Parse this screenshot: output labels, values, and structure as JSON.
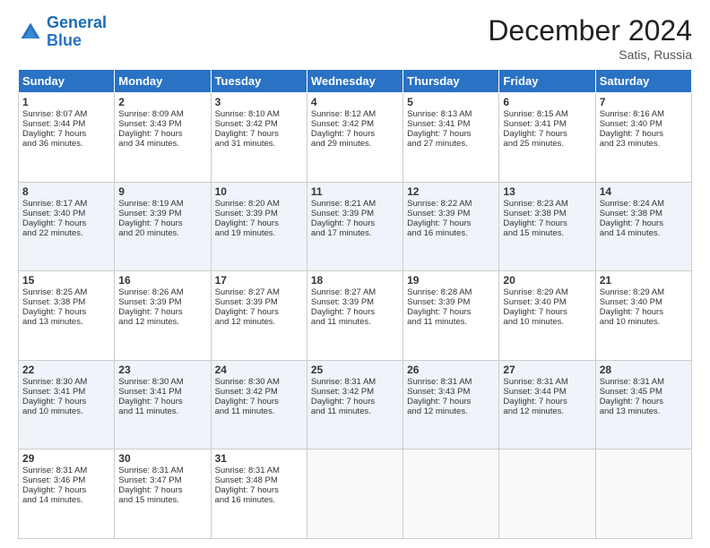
{
  "header": {
    "logo_line1": "General",
    "logo_line2": "Blue",
    "month_title": "December 2024",
    "subtitle": "Satis, Russia"
  },
  "weekdays": [
    "Sunday",
    "Monday",
    "Tuesday",
    "Wednesday",
    "Thursday",
    "Friday",
    "Saturday"
  ],
  "weeks": [
    [
      {
        "day": "1",
        "lines": [
          "Sunrise: 8:07 AM",
          "Sunset: 3:44 PM",
          "Daylight: 7 hours",
          "and 36 minutes."
        ]
      },
      {
        "day": "2",
        "lines": [
          "Sunrise: 8:09 AM",
          "Sunset: 3:43 PM",
          "Daylight: 7 hours",
          "and 34 minutes."
        ]
      },
      {
        "day": "3",
        "lines": [
          "Sunrise: 8:10 AM",
          "Sunset: 3:42 PM",
          "Daylight: 7 hours",
          "and 31 minutes."
        ]
      },
      {
        "day": "4",
        "lines": [
          "Sunrise: 8:12 AM",
          "Sunset: 3:42 PM",
          "Daylight: 7 hours",
          "and 29 minutes."
        ]
      },
      {
        "day": "5",
        "lines": [
          "Sunrise: 8:13 AM",
          "Sunset: 3:41 PM",
          "Daylight: 7 hours",
          "and 27 minutes."
        ]
      },
      {
        "day": "6",
        "lines": [
          "Sunrise: 8:15 AM",
          "Sunset: 3:41 PM",
          "Daylight: 7 hours",
          "and 25 minutes."
        ]
      },
      {
        "day": "7",
        "lines": [
          "Sunrise: 8:16 AM",
          "Sunset: 3:40 PM",
          "Daylight: 7 hours",
          "and 23 minutes."
        ]
      }
    ],
    [
      {
        "day": "8",
        "lines": [
          "Sunrise: 8:17 AM",
          "Sunset: 3:40 PM",
          "Daylight: 7 hours",
          "and 22 minutes."
        ]
      },
      {
        "day": "9",
        "lines": [
          "Sunrise: 8:19 AM",
          "Sunset: 3:39 PM",
          "Daylight: 7 hours",
          "and 20 minutes."
        ]
      },
      {
        "day": "10",
        "lines": [
          "Sunrise: 8:20 AM",
          "Sunset: 3:39 PM",
          "Daylight: 7 hours",
          "and 19 minutes."
        ]
      },
      {
        "day": "11",
        "lines": [
          "Sunrise: 8:21 AM",
          "Sunset: 3:39 PM",
          "Daylight: 7 hours",
          "and 17 minutes."
        ]
      },
      {
        "day": "12",
        "lines": [
          "Sunrise: 8:22 AM",
          "Sunset: 3:39 PM",
          "Daylight: 7 hours",
          "and 16 minutes."
        ]
      },
      {
        "day": "13",
        "lines": [
          "Sunrise: 8:23 AM",
          "Sunset: 3:38 PM",
          "Daylight: 7 hours",
          "and 15 minutes."
        ]
      },
      {
        "day": "14",
        "lines": [
          "Sunrise: 8:24 AM",
          "Sunset: 3:38 PM",
          "Daylight: 7 hours",
          "and 14 minutes."
        ]
      }
    ],
    [
      {
        "day": "15",
        "lines": [
          "Sunrise: 8:25 AM",
          "Sunset: 3:38 PM",
          "Daylight: 7 hours",
          "and 13 minutes."
        ]
      },
      {
        "day": "16",
        "lines": [
          "Sunrise: 8:26 AM",
          "Sunset: 3:39 PM",
          "Daylight: 7 hours",
          "and 12 minutes."
        ]
      },
      {
        "day": "17",
        "lines": [
          "Sunrise: 8:27 AM",
          "Sunset: 3:39 PM",
          "Daylight: 7 hours",
          "and 12 minutes."
        ]
      },
      {
        "day": "18",
        "lines": [
          "Sunrise: 8:27 AM",
          "Sunset: 3:39 PM",
          "Daylight: 7 hours",
          "and 11 minutes."
        ]
      },
      {
        "day": "19",
        "lines": [
          "Sunrise: 8:28 AM",
          "Sunset: 3:39 PM",
          "Daylight: 7 hours",
          "and 11 minutes."
        ]
      },
      {
        "day": "20",
        "lines": [
          "Sunrise: 8:29 AM",
          "Sunset: 3:40 PM",
          "Daylight: 7 hours",
          "and 10 minutes."
        ]
      },
      {
        "day": "21",
        "lines": [
          "Sunrise: 8:29 AM",
          "Sunset: 3:40 PM",
          "Daylight: 7 hours",
          "and 10 minutes."
        ]
      }
    ],
    [
      {
        "day": "22",
        "lines": [
          "Sunrise: 8:30 AM",
          "Sunset: 3:41 PM",
          "Daylight: 7 hours",
          "and 10 minutes."
        ]
      },
      {
        "day": "23",
        "lines": [
          "Sunrise: 8:30 AM",
          "Sunset: 3:41 PM",
          "Daylight: 7 hours",
          "and 11 minutes."
        ]
      },
      {
        "day": "24",
        "lines": [
          "Sunrise: 8:30 AM",
          "Sunset: 3:42 PM",
          "Daylight: 7 hours",
          "and 11 minutes."
        ]
      },
      {
        "day": "25",
        "lines": [
          "Sunrise: 8:31 AM",
          "Sunset: 3:42 PM",
          "Daylight: 7 hours",
          "and 11 minutes."
        ]
      },
      {
        "day": "26",
        "lines": [
          "Sunrise: 8:31 AM",
          "Sunset: 3:43 PM",
          "Daylight: 7 hours",
          "and 12 minutes."
        ]
      },
      {
        "day": "27",
        "lines": [
          "Sunrise: 8:31 AM",
          "Sunset: 3:44 PM",
          "Daylight: 7 hours",
          "and 12 minutes."
        ]
      },
      {
        "day": "28",
        "lines": [
          "Sunrise: 8:31 AM",
          "Sunset: 3:45 PM",
          "Daylight: 7 hours",
          "and 13 minutes."
        ]
      }
    ],
    [
      {
        "day": "29",
        "lines": [
          "Sunrise: 8:31 AM",
          "Sunset: 3:46 PM",
          "Daylight: 7 hours",
          "and 14 minutes."
        ]
      },
      {
        "day": "30",
        "lines": [
          "Sunrise: 8:31 AM",
          "Sunset: 3:47 PM",
          "Daylight: 7 hours",
          "and 15 minutes."
        ]
      },
      {
        "day": "31",
        "lines": [
          "Sunrise: 8:31 AM",
          "Sunset: 3:48 PM",
          "Daylight: 7 hours",
          "and 16 minutes."
        ]
      },
      {
        "day": "",
        "lines": []
      },
      {
        "day": "",
        "lines": []
      },
      {
        "day": "",
        "lines": []
      },
      {
        "day": "",
        "lines": []
      }
    ]
  ]
}
